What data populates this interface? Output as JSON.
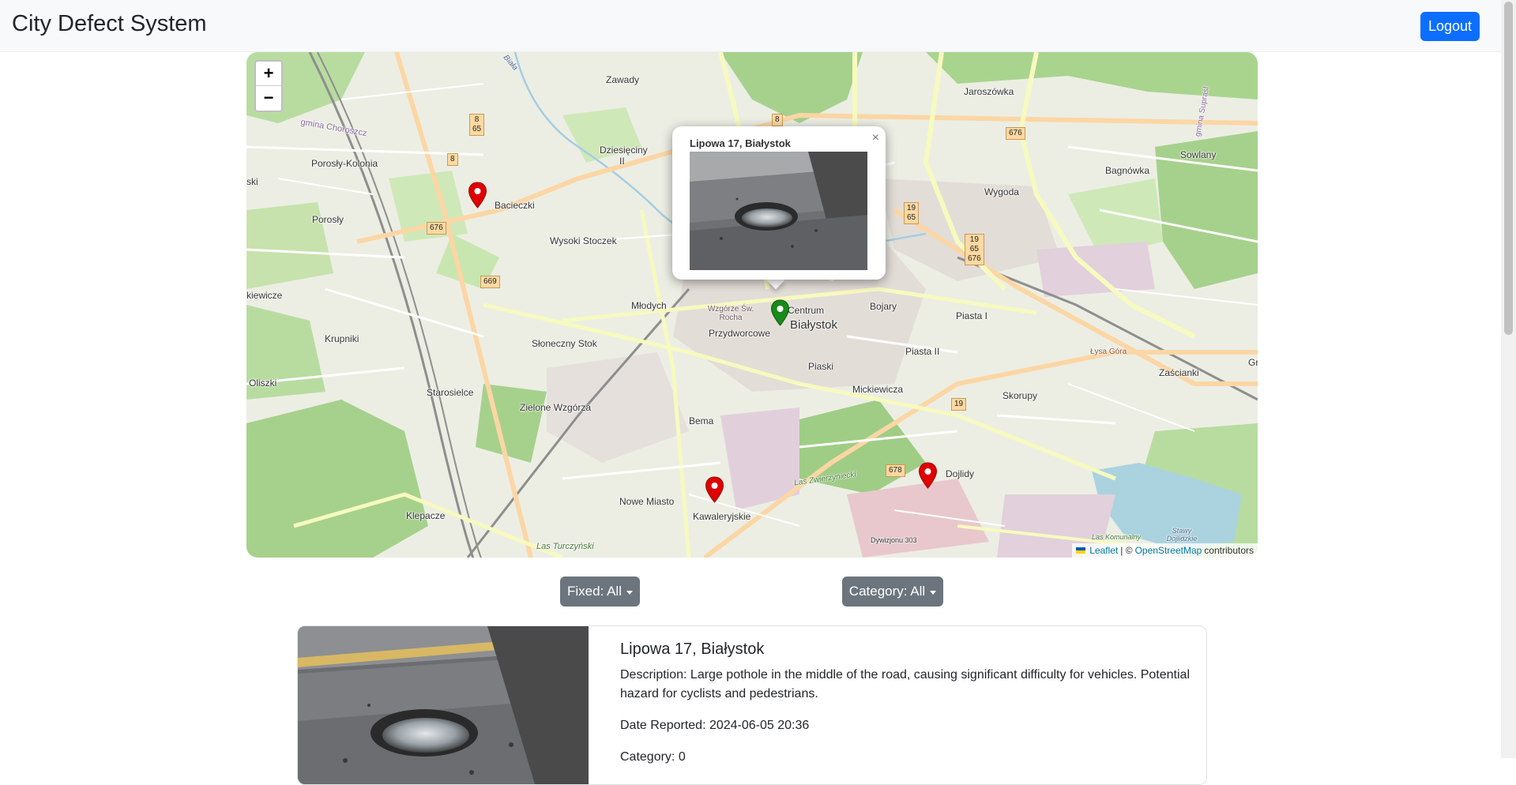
{
  "navbar": {
    "brand": "City Defect System",
    "logout_label": "Logout"
  },
  "map": {
    "zoom_in": "+",
    "zoom_out": "−",
    "labels": [
      {
        "text": "Zawady"
      },
      {
        "text": "Dziesięciny"
      },
      {
        "text": "II"
      },
      {
        "text": "Jaroszówka"
      },
      {
        "text": "Porosły-Kolonia"
      },
      {
        "text": "Bacieczki"
      },
      {
        "text": "gmina Choroszcz"
      },
      {
        "text": "Bagnówka"
      },
      {
        "text": "Sowlany"
      },
      {
        "text": "Wygoda"
      },
      {
        "text": "Porosły"
      },
      {
        "text": "Wysoki Stoczek"
      },
      {
        "text": "Młodych"
      },
      {
        "text": "Centrum"
      },
      {
        "text": "Białystok"
      },
      {
        "text": "Bojary"
      },
      {
        "text": "Piasta I"
      },
      {
        "text": "Piasta II"
      },
      {
        "text": "Przydworcowe"
      },
      {
        "text": "Wzgórze Św. Rocha"
      },
      {
        "text": "Krupniki"
      },
      {
        "text": "Słoneczny Stok"
      },
      {
        "text": "Piaski"
      },
      {
        "text": "Mickiewicza"
      },
      {
        "text": "Skorupy"
      },
      {
        "text": "Zaścianki"
      },
      {
        "text": "Oliszki"
      },
      {
        "text": "Starosielce"
      },
      {
        "text": "Zielone Wzgórza"
      },
      {
        "text": "Bema"
      },
      {
        "text": "Dojlidy"
      },
      {
        "text": "Nowe Miasto"
      },
      {
        "text": "Kawaleryjskie"
      },
      {
        "text": "Klepacze"
      },
      {
        "text": "Las Zwierzyniecki"
      },
      {
        "text": "Las Turczyński"
      },
      {
        "text": "Łysa Góra"
      },
      {
        "text": "Dywizjonu 303"
      },
      {
        "text": "Las Komunalny"
      },
      {
        "text": "Stawy Dojlidzkie"
      },
      {
        "text": "Biała"
      },
      {
        "text": "kiewicze"
      },
      {
        "text": "ski"
      },
      {
        "text": "Gr"
      },
      {
        "text": "gmina Supraśl"
      }
    ],
    "road_shields": [
      {
        "text": "8"
      },
      {
        "text": "65"
      },
      {
        "text": "8"
      },
      {
        "text": "8"
      },
      {
        "text": "676"
      },
      {
        "text": "669"
      },
      {
        "text": "19"
      },
      {
        "text": "65"
      },
      {
        "text": "19"
      },
      {
        "text": "65"
      },
      {
        "text": "676"
      },
      {
        "text": "676"
      },
      {
        "text": "19"
      },
      {
        "text": "678"
      }
    ],
    "attribution": {
      "leaflet": "Leaflet",
      "separator": "| ©",
      "osm": "OpenStreetMap",
      "suffix": "contributors"
    }
  },
  "popup": {
    "title": "Lipowa 17, Białystok",
    "close": "×"
  },
  "filters": {
    "fixed_label": "Fixed: All",
    "category_label": "Category: All"
  },
  "card": {
    "title": "Lipowa 17, Białystok",
    "description": "Description: Large pothole in the middle of the road, causing significant difficulty for vehicles. Potential hazard for cyclists and pedestrians.",
    "date": "Date Reported: 2024-06-05 20:36",
    "category": "Category: 0"
  },
  "colors": {
    "primary": "#0d6efd",
    "secondary": "#6c757d",
    "marker_red": "#e00000",
    "marker_green": "#1a8a1a"
  },
  "icons": [
    "map-marker-icon",
    "close-icon",
    "caret-down-icon",
    "ukraine-flag-icon"
  ]
}
